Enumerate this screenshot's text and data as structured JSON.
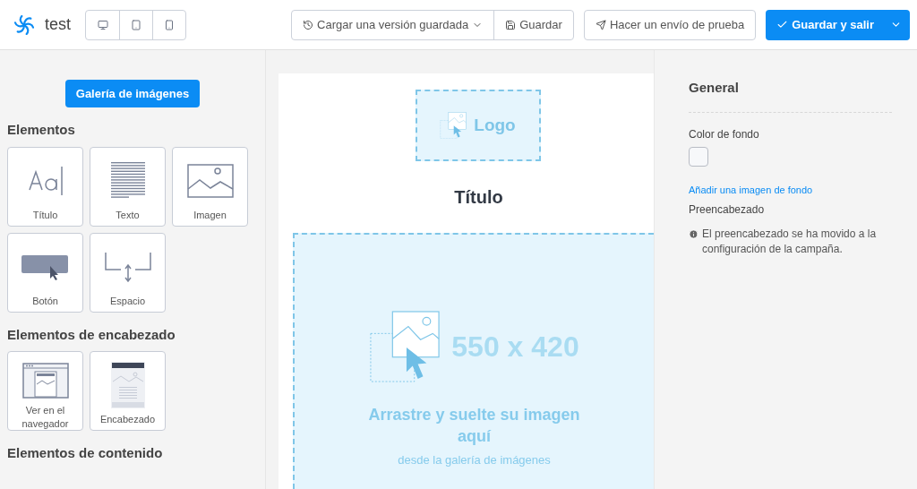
{
  "header": {
    "app_name": "test",
    "devices": [
      {
        "kind": "desktop"
      },
      {
        "kind": "tablet"
      },
      {
        "kind": "mobile"
      }
    ],
    "load_version": "Cargar una versión guardada",
    "save": "Guardar",
    "test_send": "Hacer un envío de prueba",
    "save_exit": "Guardar y salir"
  },
  "left_panel": {
    "gallery_button": "Galería de imágenes",
    "sections": [
      {
        "title": "Elementos",
        "tiles": [
          {
            "kind": "title",
            "label": "Título"
          },
          {
            "kind": "text",
            "label": "Texto"
          },
          {
            "kind": "image",
            "label": "Imagen"
          },
          {
            "kind": "button",
            "label": "Botón"
          },
          {
            "kind": "spacer",
            "label": "Espacio"
          }
        ]
      },
      {
        "title": "Elementos de encabezado",
        "tiles": [
          {
            "kind": "browser",
            "label": "Ver en el navegador"
          },
          {
            "kind": "header",
            "label": "Encabezado"
          }
        ]
      },
      {
        "title": "Elementos de contenido"
      }
    ]
  },
  "canvas": {
    "logo": "Logo",
    "title": "Título",
    "image_size": "550 x 420",
    "drop_text": "Arrastre y suelte su imagen aquí",
    "drop_subtext": "desde la galería de imágenes"
  },
  "right_panel": {
    "title": "General",
    "bg_color_label": "Color de fondo",
    "bg_image_link": "Añadir una imagen de fondo",
    "preheader_label": "Preencabezado",
    "preheader_note": "El preencabezado se ha movido a la configuración de la campaña."
  }
}
